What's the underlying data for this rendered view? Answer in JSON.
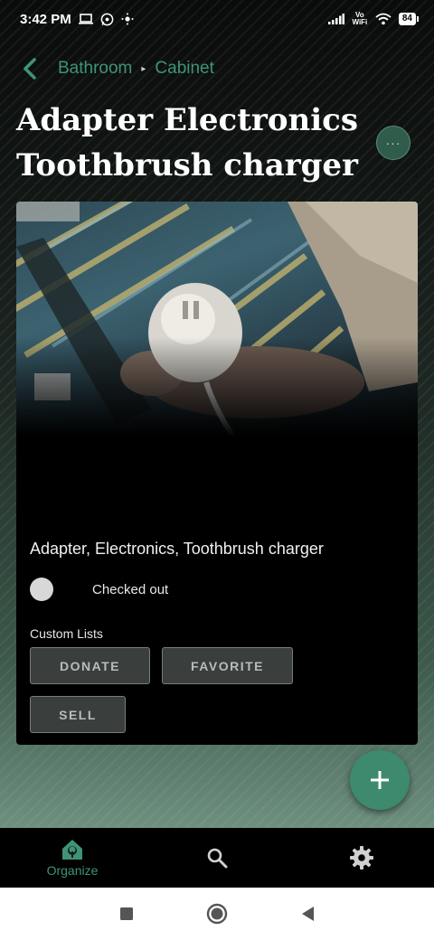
{
  "status_bar": {
    "time": "3:42 PM",
    "left_icons": [
      "laptop-icon",
      "whatsapp-icon",
      "dots-icon"
    ],
    "right_icons": [
      "signal-icon",
      "vowifi-icon",
      "wifi-icon"
    ],
    "vowifi_text": "Vo WiFi",
    "battery": "84"
  },
  "breadcrumb": {
    "back_icon": "chevron-left-icon",
    "items": [
      "Bathroom",
      "Cabinet"
    ],
    "separator": "▸"
  },
  "page": {
    "title": "Adapter Electronics Toothbrush charger",
    "more_label": "···"
  },
  "card": {
    "item_name": "Adapter, Electronics, Toothbrush charger",
    "checked_out_label": "Checked out",
    "checked_out": false,
    "custom_lists_label": "Custom Lists",
    "custom_lists": [
      "DONATE",
      "FAVORITE",
      "SELL"
    ]
  },
  "fab": {
    "icon": "plus-icon"
  },
  "bottom_nav": {
    "items": [
      {
        "label": "Organize",
        "icon": "home-tree-icon",
        "active": true
      },
      {
        "label": "",
        "icon": "search-icon",
        "active": false
      },
      {
        "label": "",
        "icon": "gear-icon",
        "active": false
      }
    ]
  },
  "system_nav": [
    "recents-square-icon",
    "home-circle-icon",
    "back-triangle-icon"
  ],
  "colors": {
    "accent": "#3e9478",
    "fab": "#3d8a6f",
    "chip_bg": "#3a3f3e",
    "card_bg": "#000000"
  }
}
